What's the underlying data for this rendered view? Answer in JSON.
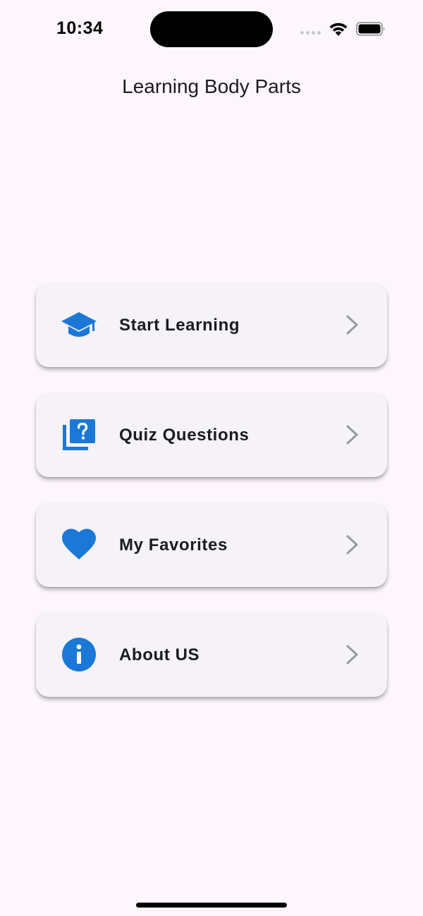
{
  "status_bar": {
    "time": "10:34"
  },
  "header": {
    "title": "Learning Body Parts"
  },
  "menu": {
    "items": [
      {
        "label": "Start Learning",
        "icon": "graduation-cap-icon"
      },
      {
        "label": "Quiz Questions",
        "icon": "quiz-icon"
      },
      {
        "label": "My Favorites",
        "icon": "heart-icon"
      },
      {
        "label": "About US",
        "icon": "info-icon"
      }
    ]
  },
  "colors": {
    "background": "#fdf7fd",
    "card": "#f5f2f8",
    "accent": "#1b78d6",
    "chevron": "#9a9a9e"
  }
}
